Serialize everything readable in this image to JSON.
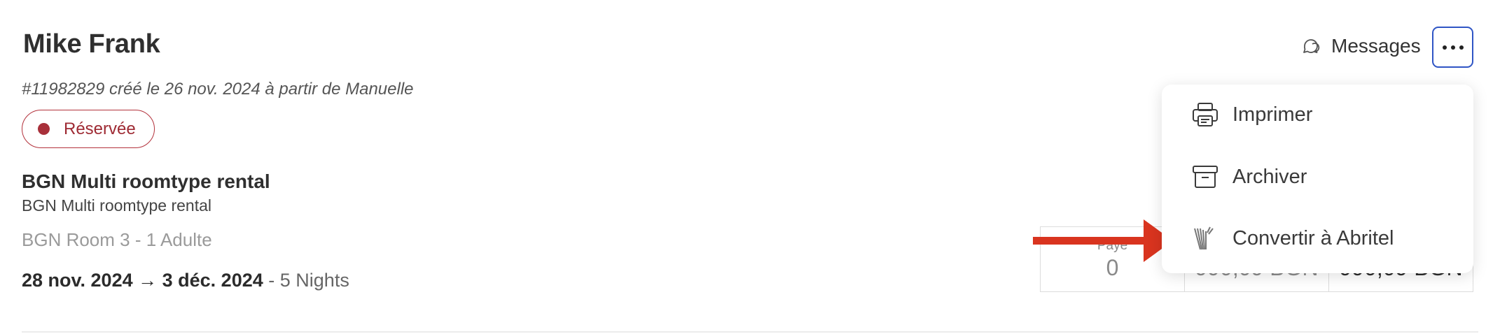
{
  "reservation": {
    "guest_name": "Mike Frank",
    "meta": "#11982829 créé le 26 nov. 2024 à partir de Manuelle",
    "status": "Réservée",
    "rental_title": "BGN Multi roomtype rental",
    "rental_subtitle": "BGN Multi roomtype rental",
    "room_line": "BGN Room 3 - 1 Adulte",
    "date_start": "28 nov. 2024",
    "date_arrow": "→",
    "date_end": "3 déc. 2024",
    "nights": "- 5 Nights"
  },
  "header": {
    "messages_label": "Messages"
  },
  "payment": {
    "paid_label": "Payé",
    "paid_value": "0",
    "amount_due_visible": "990,09 BGN",
    "total_visible": "990,09 BGN"
  },
  "menu": {
    "items": [
      {
        "label": "Imprimer",
        "icon": "printer-icon"
      },
      {
        "label": "Archiver",
        "icon": "archive-icon"
      },
      {
        "label": "Convertir à Abritel",
        "icon": "abritel-logo-icon"
      }
    ]
  },
  "colors": {
    "status": "#a8303a",
    "focus_border": "#2f55c5",
    "annotation_arrow": "#d9341f"
  }
}
